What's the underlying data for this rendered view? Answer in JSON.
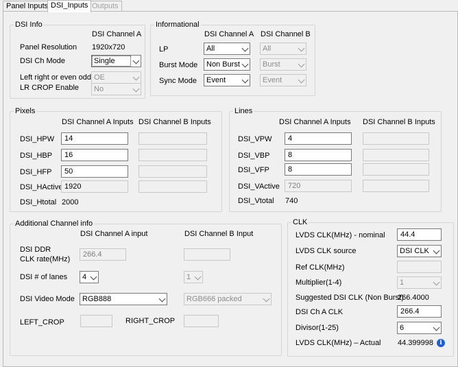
{
  "tabs": [
    {
      "label": "Panel Inputs",
      "state": "normal"
    },
    {
      "label": "DSI_Inputs",
      "state": "active"
    },
    {
      "label": "Outputs",
      "state": "disabled"
    }
  ],
  "dsi_info": {
    "title": "DSI Info",
    "col_a": "DSI Channel A",
    "panel_resolution_label": "Panel Resolution",
    "panel_resolution_value": "1920x720",
    "ch_mode_label": "DSI Ch Mode",
    "ch_mode_value": "Single",
    "lr_label": "Left right or even odd",
    "lr_value": "OE",
    "crop_label": "LR CROP Enable",
    "crop_value": "No"
  },
  "informational": {
    "title": "Informational",
    "col_a": "DSI Channel A",
    "col_b": "DSI Channel B",
    "lp_label": "LP",
    "lp_a": "All",
    "lp_b": "All",
    "burst_label": "Burst Mode",
    "burst_a": "Non Burst",
    "burst_b": "Burst",
    "sync_label": "Sync Mode",
    "sync_a": "Event",
    "sync_b": "Event"
  },
  "pixels": {
    "title": "Pixels",
    "col_a": "DSI Channel A Inputs",
    "col_b": "DSI Channel B Inputs",
    "hpw_label": "DSI_HPW",
    "hpw_a": "14",
    "hbp_label": "DSI_HBP",
    "hbp_a": "16",
    "hfp_label": "DSI_HFP",
    "hfp_a": "50",
    "hactive_label": "DSI_HActive",
    "hactive_a": "1920",
    "htotal_label": "DSI_Htotal",
    "htotal_a": "2000"
  },
  "lines": {
    "title": "Lines",
    "col_a": "DSI Channel A Inputs",
    "col_b": "DSI Channel B Inputs",
    "vpw_label": "DSI_VPW",
    "vpw_a": "4",
    "vbp_label": "DSI_VBP",
    "vbp_a": "8",
    "vfp_label": "DSI_VFP",
    "vfp_a": "8",
    "vactive_label": "DSI_VActive",
    "vactive_a": "720",
    "vtotal_label": "DSI_Vtotal",
    "vtotal_a": "740"
  },
  "additional": {
    "title": "Additional Channel info",
    "col_a": "DSI Channel A input",
    "col_b": "DSI Channel B Input",
    "ddr_label_1": "DSI DDR",
    "ddr_label_2": "CLK rate(MHz)",
    "ddr_a": "266.4",
    "ddr_b": "",
    "lanes_label": "DSI # of lanes",
    "lanes_a": "4",
    "lanes_b": "1",
    "video_mode_label": "DSI Video Mode",
    "video_mode_a": "RGB888",
    "video_mode_b": "RGB666 packed",
    "left_crop_label": "LEFT_CROP",
    "left_crop_value": "",
    "right_crop_label": "RIGHT_CROP",
    "right_crop_value": ""
  },
  "clk": {
    "title": "CLK",
    "lvds_nominal_label": "LVDS CLK(MHz) - nominal",
    "lvds_nominal_value": "44.4",
    "lvds_source_label": "LVDS CLK source",
    "lvds_source_value": "DSI CLK",
    "ref_clk_label": "Ref CLK(MHz)",
    "ref_clk_value": "",
    "multiplier_label": "Multiplier(1-4)",
    "multiplier_value": "1",
    "suggested_label": "Suggested DSI CLK (Non Burst)",
    "suggested_value": "266.4000",
    "ch_a_clk_label": "DSI Ch A CLK",
    "ch_a_clk_value": "266.4",
    "divisor_label": "Divisor(1-25)",
    "divisor_value": "6",
    "lvds_actual_label": "LVDS CLK(MHz) – Actual",
    "lvds_actual_value": "44.399998",
    "info_icon_glyph": "i",
    "info_icon_name": "info-icon"
  }
}
